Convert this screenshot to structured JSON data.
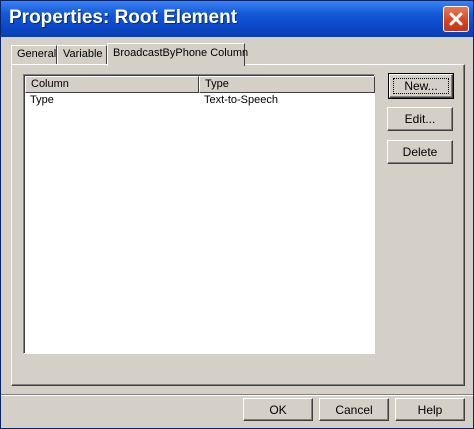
{
  "window": {
    "title": "Properties: Root Element",
    "close_icon": "close-icon",
    "titlebar_color": "#0a48c9",
    "close_color": "#d3431f"
  },
  "tabs": [
    {
      "label": "General"
    },
    {
      "label": "Variable"
    },
    {
      "label": "BroadcastByPhone Column",
      "active": true
    }
  ],
  "list": {
    "columns": [
      "Column",
      "Type"
    ],
    "rows": [
      [
        "Type",
        "Text-to-Speech"
      ]
    ]
  },
  "side_buttons": {
    "new": "New...",
    "edit": "Edit...",
    "delete": "Delete"
  },
  "footer_buttons": {
    "ok": "OK",
    "cancel": "Cancel",
    "help": "Help"
  }
}
